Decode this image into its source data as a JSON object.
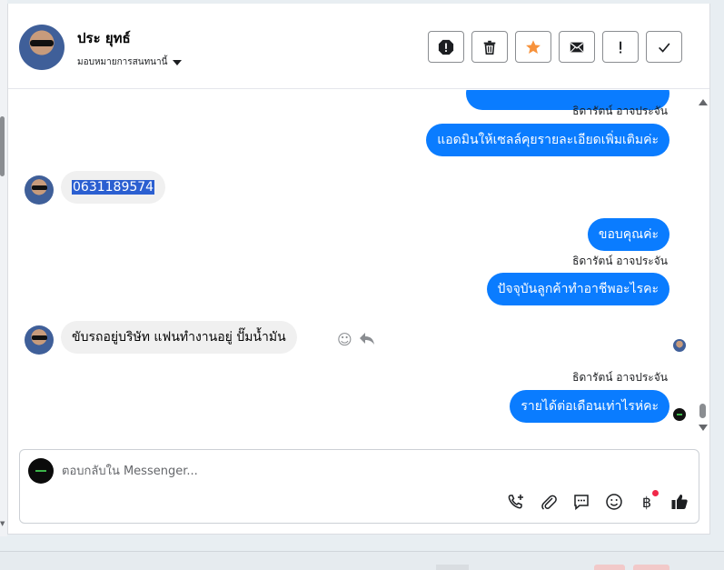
{
  "header": {
    "contact_name": "ประ ยุทธ์",
    "assign_label": "มอบหมายการสนทนานี้"
  },
  "actions": [
    {
      "name": "report-spam-button",
      "icon": "exclamation-octagon-icon"
    },
    {
      "name": "delete-button",
      "icon": "trash-icon"
    },
    {
      "name": "star-button",
      "icon": "star-icon"
    },
    {
      "name": "mark-unread-button",
      "icon": "envelope-icon"
    },
    {
      "name": "important-button",
      "icon": "exclamation-icon"
    },
    {
      "name": "done-button",
      "icon": "check-icon"
    }
  ],
  "colors": {
    "outgoing_bubble": "#0a7cff",
    "incoming_bubble": "#f0f0f0",
    "star": "#f7923b",
    "selection": "#2b5fd1"
  },
  "thread": {
    "sender_name": "ธิดารัตน์ อาจประจัน",
    "messages": [
      {
        "direction": "out",
        "text": "แอดมินให้เซลล์คุยรายละเอียดเพิ่มเติมค่ะ"
      },
      {
        "direction": "in",
        "text": "0631189574",
        "selected": true
      },
      {
        "direction": "out",
        "text": "ขอบคุณค่ะ"
      },
      {
        "direction": "out",
        "text": "ปัจจุบันลูกค้าทำอาชีพอะไรคะ"
      },
      {
        "direction": "in",
        "text": "ขับรถอยู่บริษัท   แฟนทำงานอยู่  ปั๊มน้ำมัน"
      },
      {
        "direction": "out",
        "text": "รายได้ต่อเดือนเท่าไรห่คะ"
      }
    ]
  },
  "composer": {
    "placeholder": "ตอบกลับใน Messenger..."
  },
  "tools": [
    {
      "name": "add-contact-icon"
    },
    {
      "name": "attach-icon"
    },
    {
      "name": "saved-replies-icon"
    },
    {
      "name": "emoji-icon"
    },
    {
      "name": "payment-baht-icon",
      "badge": true
    },
    {
      "name": "like-icon"
    }
  ]
}
